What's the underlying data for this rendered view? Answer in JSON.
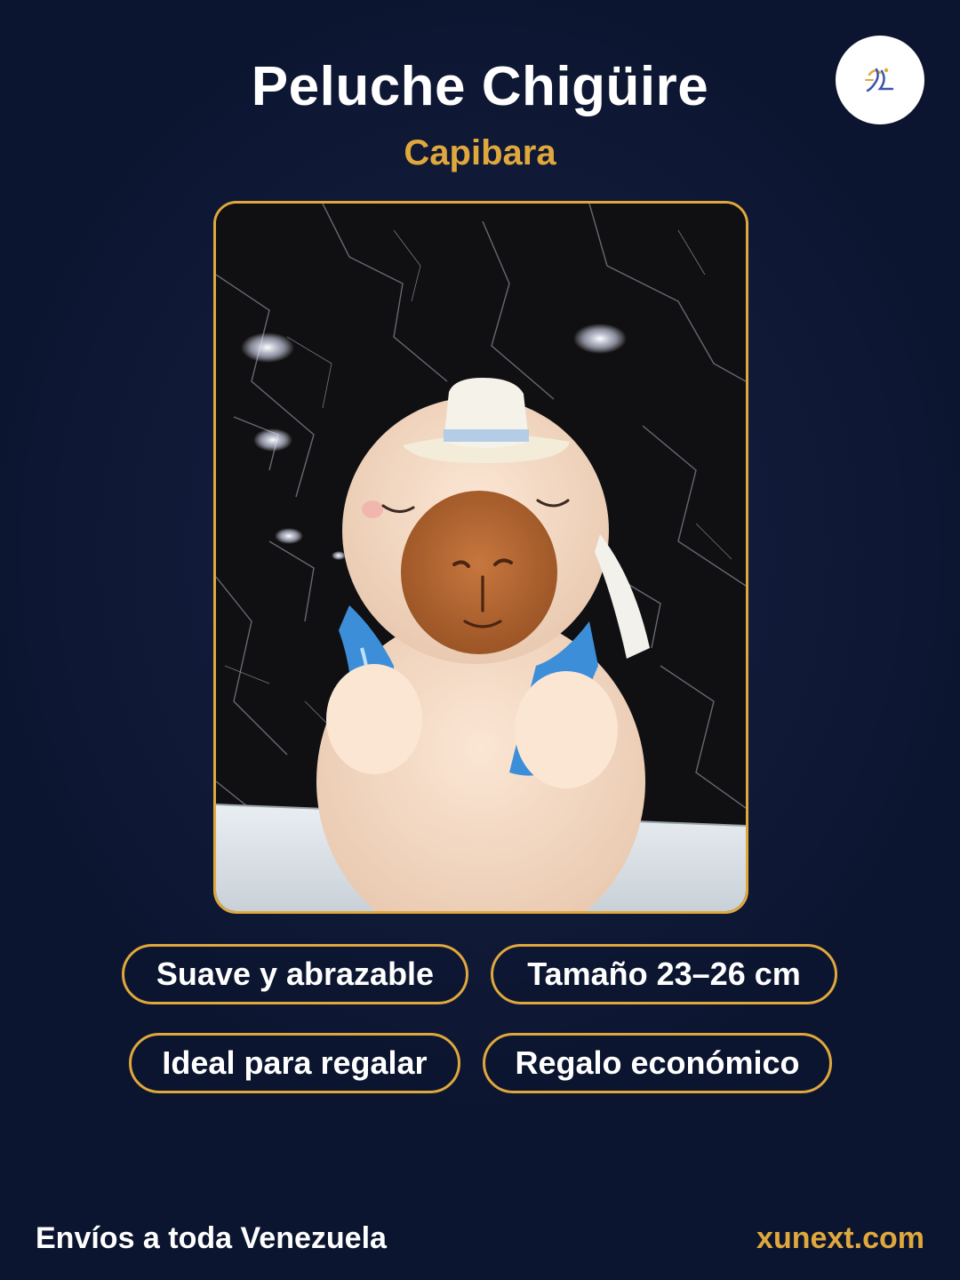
{
  "header": {
    "title": "Peluche Chigüire",
    "subtitle": "Capibara"
  },
  "logo": {
    "icon": "brand-logo-icon"
  },
  "photo": {
    "icon": "capybara-plush-photo"
  },
  "features": [
    {
      "label": "Suave y abrazable"
    },
    {
      "label": "Tamaño 23–26 cm"
    },
    {
      "label": "Ideal para regalar"
    },
    {
      "label": "Regalo económico"
    }
  ],
  "footer": {
    "shipping": "Envíos a toda Venezuela",
    "website": "xunext.com"
  },
  "colors": {
    "background": "#0c1530",
    "accent": "#e0a83c",
    "text": "#ffffff"
  }
}
